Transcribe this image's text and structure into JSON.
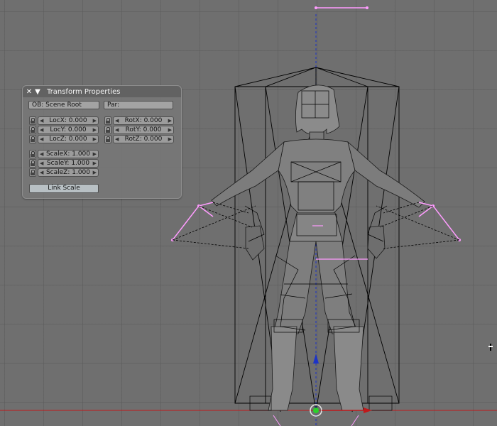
{
  "panel": {
    "title": "Transform Properties",
    "ob_field": "OB: Scene Root",
    "par_field": "Par:",
    "loc": [
      "LocX: 0.000",
      "LocY: 0.000",
      "LocZ: 0.000"
    ],
    "rot": [
      "RotX: 0.000",
      "RotY: 0.000",
      "RotZ: 0.000"
    ],
    "scale": [
      "ScaleX: 1.000",
      "ScaleY: 1.000",
      "ScaleZ: 1.000"
    ],
    "link_scale": "Link Scale"
  },
  "icons": {
    "close": "close-icon",
    "collapse": "collapse-triangle-icon",
    "lock": "lock-icon",
    "cursor": "3d-cursor-icon"
  },
  "colors": {
    "viewport_bg": "#6f6f6f",
    "grid": "#5a5a5a",
    "wire": "#000000",
    "armature": "#ff9cff",
    "axis_red": "#c0191b",
    "axis_blue": "#1c33c8",
    "manipulator_green": "#2bd12b"
  }
}
